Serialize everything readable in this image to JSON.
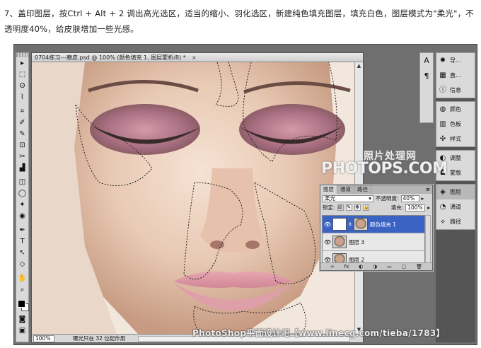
{
  "caption": "7、盖印图层，按Ctrl + Alt + 2 调出高光选区，适当的缩小、羽化选区，新建纯色填充图层，填充白色，图层模式为\"柔光\"，不透明度40%，给皮肤增加一些光感。",
  "document": {
    "title": "0704练习---磨皮.psd @ 100% (颜色填充 1, 图层蒙析/8) *",
    "close_glyph": "×",
    "zoom": "100%",
    "status_info": "曝光只在 32 位起作用"
  },
  "tools": [
    "▸",
    "⬚",
    "ʘ",
    "⌇",
    "⌗",
    "✐",
    "✎",
    "⊡",
    "✂",
    "▟",
    "◫",
    "◯",
    "✦",
    "◉",
    "✒",
    "T",
    "↖",
    "◇",
    "✋",
    "⌕"
  ],
  "tool_icons": [
    "move-icon",
    "marquee-icon",
    "lasso-icon",
    "magic-wand-icon",
    "crop-icon",
    "eyedropper-icon",
    "brush-icon",
    "clone-stamp-icon",
    "history-brush-icon",
    "eraser-icon",
    "gradient-icon",
    "blur-icon",
    "dodge-icon",
    "sponge-icon",
    "pen-icon",
    "type-icon",
    "path-select-icon",
    "shape-icon",
    "hand-icon",
    "zoom-icon"
  ],
  "dock_strip": [
    "A",
    "¶"
  ],
  "right_panels": [
    [
      {
        "icon": "✹",
        "label": "导..."
      },
      {
        "icon": "▦",
        "label": "直..."
      },
      {
        "icon": "ⓘ",
        "label": "信息"
      }
    ],
    [
      {
        "icon": "◍",
        "label": "颜色"
      },
      {
        "icon": "▥",
        "label": "色板"
      },
      {
        "icon": "✣",
        "label": "样式"
      }
    ],
    [
      {
        "icon": "◐",
        "label": "调整"
      },
      {
        "icon": "◘",
        "label": "蒙版"
      }
    ],
    [
      {
        "icon": "◈",
        "label": "图层",
        "active": true
      },
      {
        "icon": "◔",
        "label": "通道"
      },
      {
        "icon": "⟡",
        "label": "路径"
      }
    ]
  ],
  "layers_panel": {
    "tabs": [
      "图层",
      "通道",
      "路径"
    ],
    "menu_glyph": "≡",
    "blend_mode": "柔光",
    "opacity_label": "不透明度:",
    "opacity_value": "40%",
    "lock_label": "锁定:",
    "fill_label": "填充:",
    "fill_value": "100%",
    "layers": [
      {
        "name": "颜色填充 1",
        "selected": true,
        "thumb": "white",
        "link": "8"
      },
      {
        "name": "图层 3",
        "selected": false,
        "thumb": "face",
        "link": ""
      },
      {
        "name": "图层 2",
        "selected": false,
        "thumb": "face",
        "link": ""
      }
    ],
    "footer_icons": [
      "∞",
      "fx",
      "◐",
      "◑",
      "▭",
      "▢",
      "🗑"
    ]
  },
  "watermarks": {
    "site_cn": "照片处理网",
    "site_en": "PHOTOPS.COM",
    "bottom": "PhotoShop平面设计吧【www.linecg.com/tieba/1783】"
  }
}
